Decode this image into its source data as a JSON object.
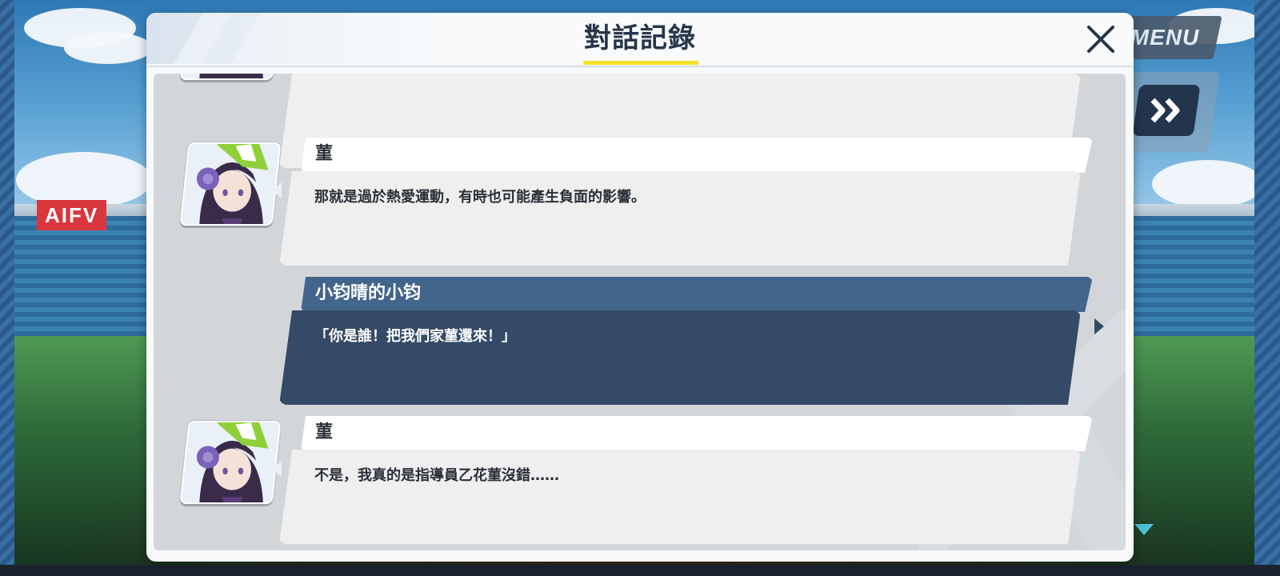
{
  "hud": {
    "menu_label": "MENU",
    "skip_icon": "fast-forward-icon",
    "scroll_indicator_icon": "triangle-down-icon"
  },
  "background": {
    "sign_text": "AIFV"
  },
  "log": {
    "title": "對話記錄",
    "close_icon": "close-icon",
    "accent_color": "#f4e12a",
    "entries": [
      {
        "speaker": "",
        "text": "",
        "type": "npc",
        "avatar": "avatar-icon"
      },
      {
        "speaker": "菫",
        "text": "那就是過於熱愛運動，有時也可能產生負面的影響。",
        "type": "npc",
        "avatar": "avatar-icon"
      },
      {
        "speaker": "小钧晴的小钧",
        "text": "「你是誰！把我們家菫還來！」",
        "type": "player"
      },
      {
        "speaker": "菫",
        "text": "不是，我真的是指導員乙花菫沒錯……",
        "type": "npc",
        "avatar": "avatar-icon"
      }
    ]
  }
}
